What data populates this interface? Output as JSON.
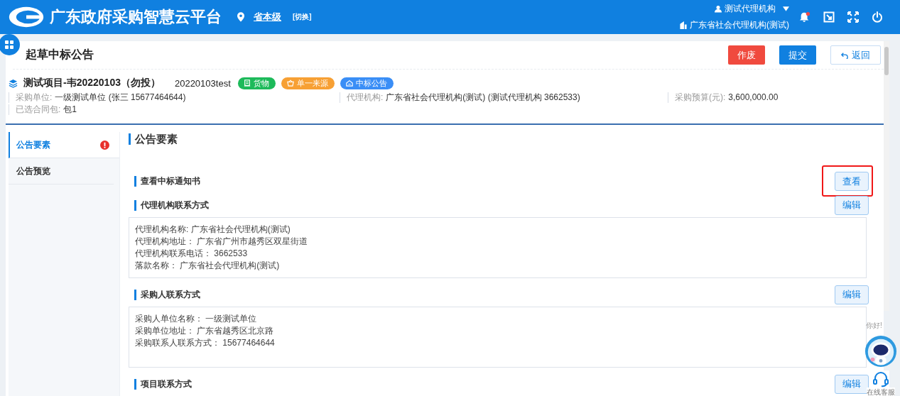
{
  "header": {
    "title": "广东政府采购智慧云平台",
    "region": "省本级",
    "switch": "[切换]",
    "user": "测试代理机构",
    "org": "广东省社会代理机构(测试)",
    "notification": true
  },
  "page": {
    "title": "起草中标公告",
    "actions": [
      {
        "label": "作废",
        "kind": "danger"
      },
      {
        "label": "提交",
        "kind": "primary"
      },
      {
        "label": "返回",
        "kind": "back"
      }
    ]
  },
  "project": {
    "name": "测试项目-韦20220103（勿投）",
    "code": "20220103test",
    "tags": [
      {
        "label": "货物",
        "kind": "goods",
        "color": "#1dba5a"
      },
      {
        "label": "单一来源",
        "kind": "basket",
        "color": "#f7a034"
      },
      {
        "label": "中标公告",
        "kind": "notice",
        "color": "#3a8ef6"
      }
    ],
    "meta": [
      {
        "label": "采购单位:",
        "value": "一级测试单位 (张三 15677464644)"
      },
      {
        "label": "代理机构:",
        "value": "广东省社会代理机构(测试) (测试代理机构 3662533)"
      },
      {
        "label": "采购预算(元):",
        "value": "3,600,000.00"
      },
      {
        "label": "已选合同包:",
        "value": "包1"
      }
    ]
  },
  "sidebar": {
    "items": [
      {
        "label": "公告要素",
        "selected": true,
        "alert": true
      },
      {
        "label": "公告预览",
        "selected": false,
        "alert": false
      }
    ]
  },
  "content": {
    "title": "公告要素",
    "sections": [
      {
        "title": "查看中标通知书",
        "button": "查看",
        "highlighted": true
      },
      {
        "title": "代理机构联系方式",
        "button": "编辑",
        "highlighted": false,
        "lines": [
          "代理机构名称: 广东省社会代理机构(测试)",
          "代理机构地址：  广东省广州市越秀区双星街道",
          "代理机构联系电话：  3662533",
          "落款名称：  广东省社会代理机构(测试)"
        ]
      },
      {
        "title": "采购人联系方式",
        "button": "编辑",
        "highlighted": false,
        "lines": [
          "采购人单位名称：  一级测试单位",
          "采购单位地址：  广东省越秀区北京路",
          "采购联系人联系方式：  15677464644"
        ]
      },
      {
        "title": "项目联系方式",
        "button": "编辑",
        "highlighted": false
      }
    ]
  },
  "assistant": {
    "greeting": "你好!",
    "label": "在线客服"
  }
}
